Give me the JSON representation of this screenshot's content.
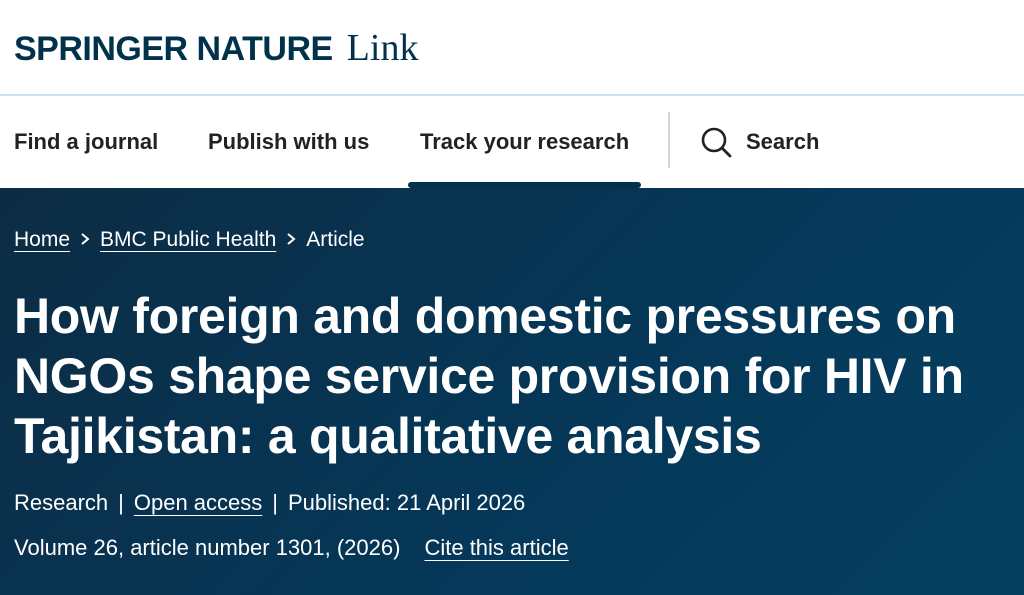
{
  "brand": {
    "name": "SPRINGER NATURE",
    "product": "Link"
  },
  "nav": {
    "items": [
      {
        "label": "Find a journal"
      },
      {
        "label": "Publish with us"
      },
      {
        "label": "Track your research"
      }
    ],
    "active": "Track your research",
    "search_label": "Search"
  },
  "breadcrumb": {
    "items": [
      {
        "label": "Home"
      },
      {
        "label": "BMC Public Health"
      },
      {
        "label": "Article"
      }
    ]
  },
  "article": {
    "title": "How foreign and domestic pressures on NGOs shape service provision for HIV in Tajikistan: a qualitative analysis",
    "type": "Research",
    "access": "Open access",
    "published": "Published: 21 April 2026",
    "citation_info": "Volume 26, article number 1301, (2026)",
    "cite_label": "Cite this article"
  },
  "colors": {
    "brand_navy": "#01324b",
    "hero_background": "#053859",
    "nav_underline": "#01324b"
  },
  "icons": {
    "search": "search-icon",
    "breadcrumb_separator": "chevron-right-icon"
  }
}
